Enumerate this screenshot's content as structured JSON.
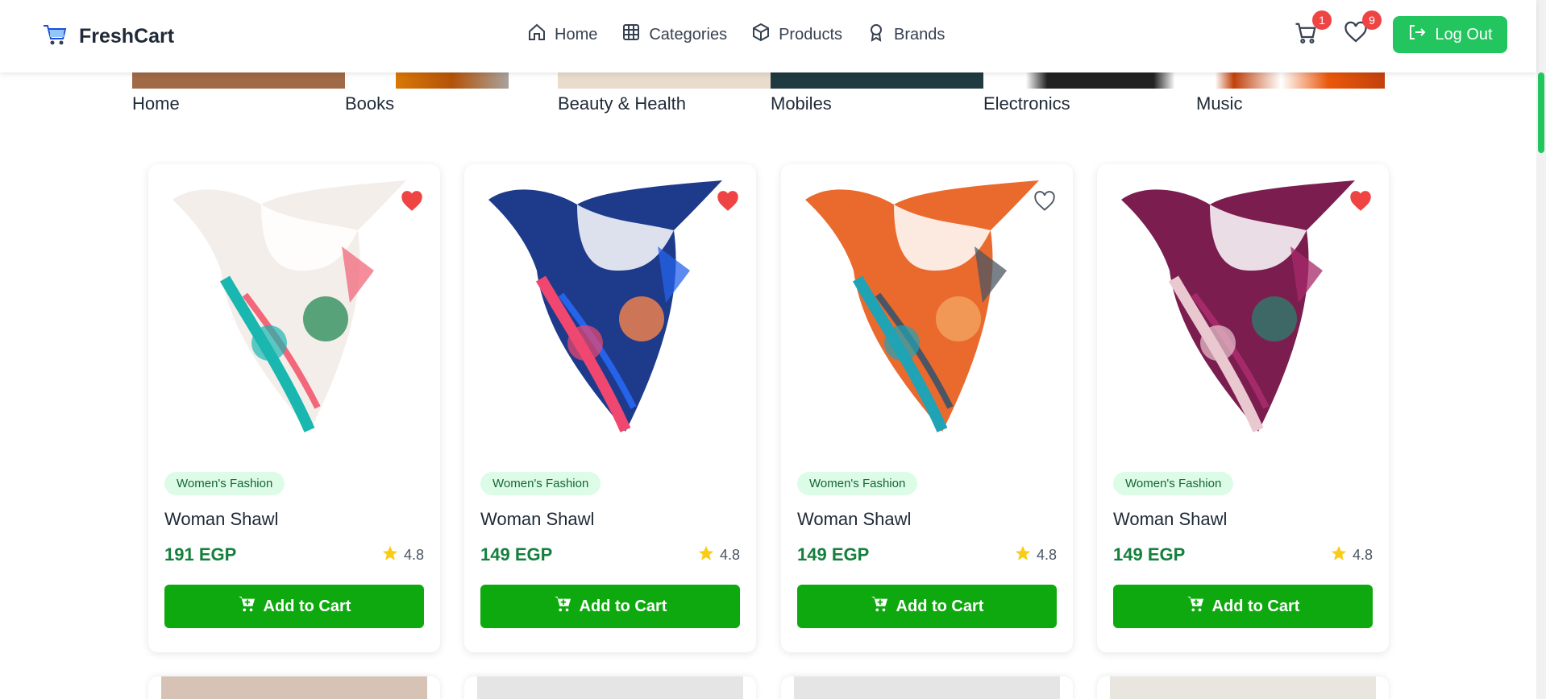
{
  "navbar": {
    "brand": "FreshCart",
    "links": [
      {
        "label": "Home",
        "icon": "home-icon"
      },
      {
        "label": "Categories",
        "icon": "grid-icon"
      },
      {
        "label": "Products",
        "icon": "box-icon"
      },
      {
        "label": "Brands",
        "icon": "badge-icon"
      }
    ],
    "cart_count": "1",
    "wishlist_count": "9",
    "logout_label": "Log Out"
  },
  "categories": [
    {
      "label": "Home"
    },
    {
      "label": "Books"
    },
    {
      "label": "Beauty & Health"
    },
    {
      "label": "Mobiles"
    },
    {
      "label": "Electronics"
    },
    {
      "label": "Music"
    }
  ],
  "products": [
    {
      "category": "Women's Fashion",
      "title": "Woman Shawl",
      "price": "191 EGP",
      "rating": "4.8",
      "wishlisted": true,
      "colors": [
        "#f3eeea",
        "#19b7b0",
        "#2f8f5b",
        "#f2677a"
      ]
    },
    {
      "category": "Women's Fashion",
      "title": "Woman Shawl",
      "price": "149 EGP",
      "rating": "4.8",
      "wishlisted": true,
      "colors": [
        "#1e3a8a",
        "#ef476f",
        "#f9844a",
        "#2563eb"
      ]
    },
    {
      "category": "Women's Fashion",
      "title": "Woman Shawl",
      "price": "149 EGP",
      "rating": "4.8",
      "wishlisted": false,
      "colors": [
        "#ea6a2e",
        "#1fa3b5",
        "#f4a460",
        "#4b5563"
      ]
    },
    {
      "category": "Women's Fashion",
      "title": "Woman Shawl",
      "price": "149 EGP",
      "rating": "4.8",
      "wishlisted": true,
      "colors": [
        "#7b1e4f",
        "#e9c8cf",
        "#2f7a6b",
        "#a52a6a"
      ]
    }
  ],
  "add_to_cart_label": "Add to Cart",
  "theme": {
    "green": "#0ea90e",
    "accent": "#22c55e",
    "price": "#15803d",
    "badge": "#ef4444",
    "heart": "#ef4444",
    "star": "#facc15"
  }
}
